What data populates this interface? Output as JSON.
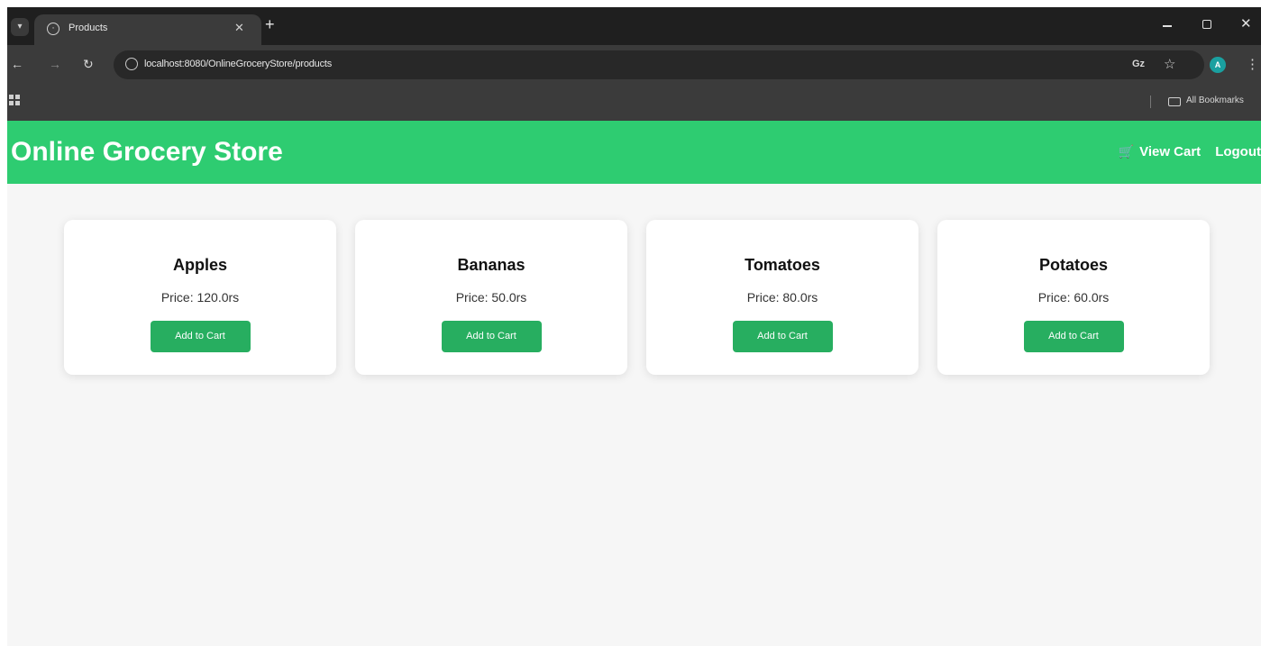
{
  "browser": {
    "tab_title": "Products",
    "url": "localhost:8080/OnlineGroceryStore/products",
    "profile_initial": "A",
    "bookmarks_label": "All Bookmarks"
  },
  "header": {
    "site_title": "Online Grocery Store",
    "view_cart_label": "View Cart",
    "logout_label": "Logout",
    "background_color": "#2ecc71"
  },
  "products": [
    {
      "name": "Apples",
      "price": "Price: 120.0rs",
      "button_label": "Add to Cart"
    },
    {
      "name": "Bananas",
      "price": "Price: 50.0rs",
      "button_label": "Add to Cart"
    },
    {
      "name": "Tomatoes",
      "price": "Price: 80.0rs",
      "button_label": "Add to Cart"
    },
    {
      "name": "Potatoes",
      "price": "Price: 60.0rs",
      "button_label": "Add to Cart"
    }
  ],
  "colors": {
    "button": "#27ae60",
    "page_background": "#f6f6f6"
  }
}
